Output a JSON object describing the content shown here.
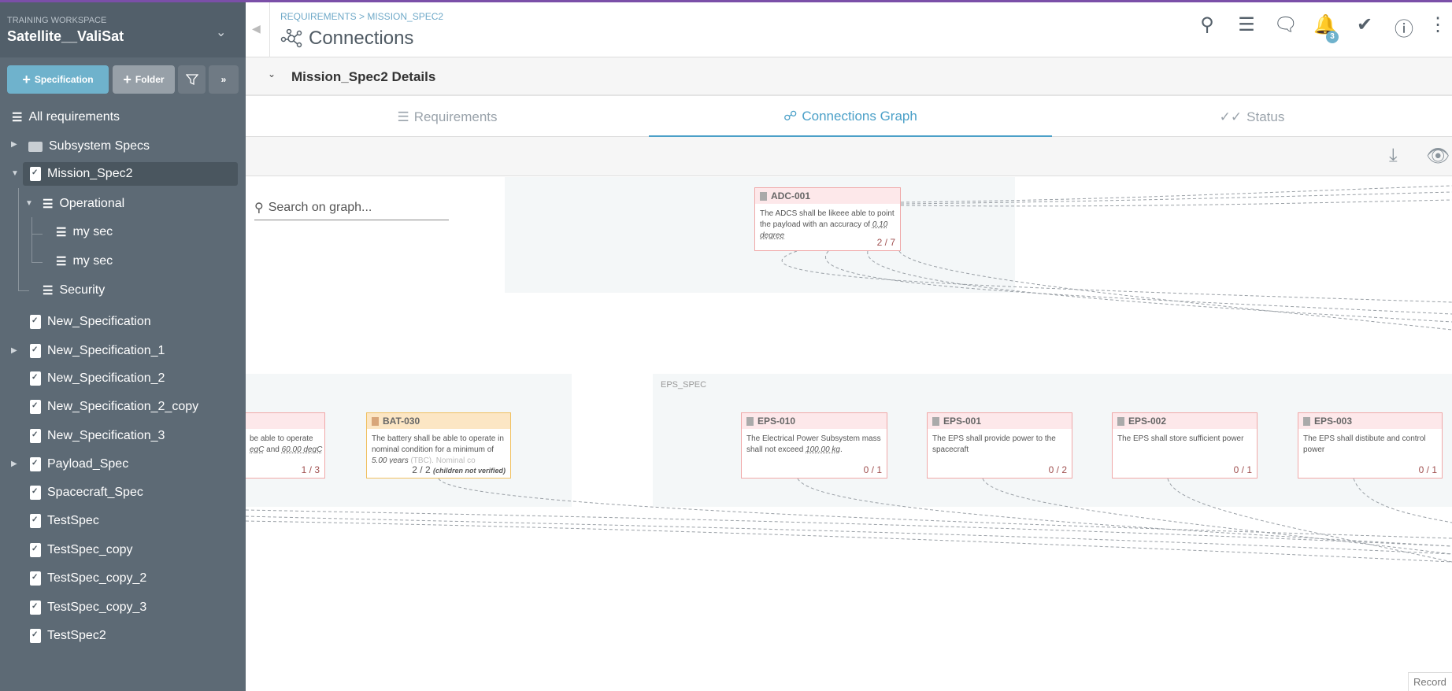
{
  "workspace": {
    "label": "TRAINING WORKSPACE",
    "name": "Satellite__ValiSat"
  },
  "sidebar": {
    "buttons": {
      "specification": "Specification",
      "folder": "Folder"
    },
    "items": [
      {
        "label": "All requirements"
      },
      {
        "label": "Subsystem Specs"
      },
      {
        "label": "Mission_Spec2"
      },
      {
        "label": "Operational"
      },
      {
        "label": "my sec"
      },
      {
        "label": "my sec"
      },
      {
        "label": "Security"
      },
      {
        "label": "New_Specification"
      },
      {
        "label": "New_Specification_1"
      },
      {
        "label": "New_Specification_2"
      },
      {
        "label": "New_Specification_2_copy"
      },
      {
        "label": "New_Specification_3"
      },
      {
        "label": "Payload_Spec"
      },
      {
        "label": "Spacecraft_Spec"
      },
      {
        "label": "TestSpec"
      },
      {
        "label": "TestSpec_copy"
      },
      {
        "label": "TestSpec_copy_2"
      },
      {
        "label": "TestSpec_copy_3"
      },
      {
        "label": "TestSpec2"
      }
    ]
  },
  "header": {
    "breadcrumb": "REQUIREMENTS > MISSION_SPEC2",
    "title": "Connections",
    "notification_count": "3"
  },
  "details": {
    "title": "Mission_Spec2 Details"
  },
  "tabs": [
    {
      "label": "Requirements"
    },
    {
      "label": "Connections Graph"
    },
    {
      "label": "Status"
    }
  ],
  "graph": {
    "search_placeholder": "Search on graph...",
    "groups": {
      "eps": "EPS_SPEC"
    },
    "nodes": {
      "adc": {
        "id": "ADC-001",
        "text": "The ADCS shall be likeee able to point the payload with an accuracy of ",
        "value": "0.10 degree",
        "count": "2 / 7"
      },
      "partial": {
        "text_a": "be able to operate",
        "value_a": "egC",
        "text_b": " and ",
        "value_b": "60.00 degC",
        "count": "1 / 3"
      },
      "bat": {
        "id": "BAT-030",
        "text": "The battery shall be able to operate in nominal condition for a minimum of ",
        "value": "5.00 years",
        "text2": " (TBC). Nominal co",
        "count": "2 / 2",
        "note": "(children not verified)"
      },
      "eps010": {
        "id": "EPS-010",
        "text": "The Electrical Power Subsystem mass shall not exceed ",
        "value": "100.00 kg",
        "text2": ".",
        "count": "0 / 1"
      },
      "eps001": {
        "id": "EPS-001",
        "text": "The EPS shall provide power to the spacecraft",
        "count": "0 / 2"
      },
      "eps002": {
        "id": "EPS-002",
        "text": "The EPS shall store sufficient power",
        "count": "0 / 1"
      },
      "eps003": {
        "id": "EPS-003",
        "text": "The EPS shall distibute and control power",
        "count": "0 / 1"
      }
    }
  },
  "record": "Record",
  "colors": {
    "accent": "#6fb2cc",
    "sidebar": "#5d6a75",
    "brand_bar": "#7b4fa8"
  }
}
